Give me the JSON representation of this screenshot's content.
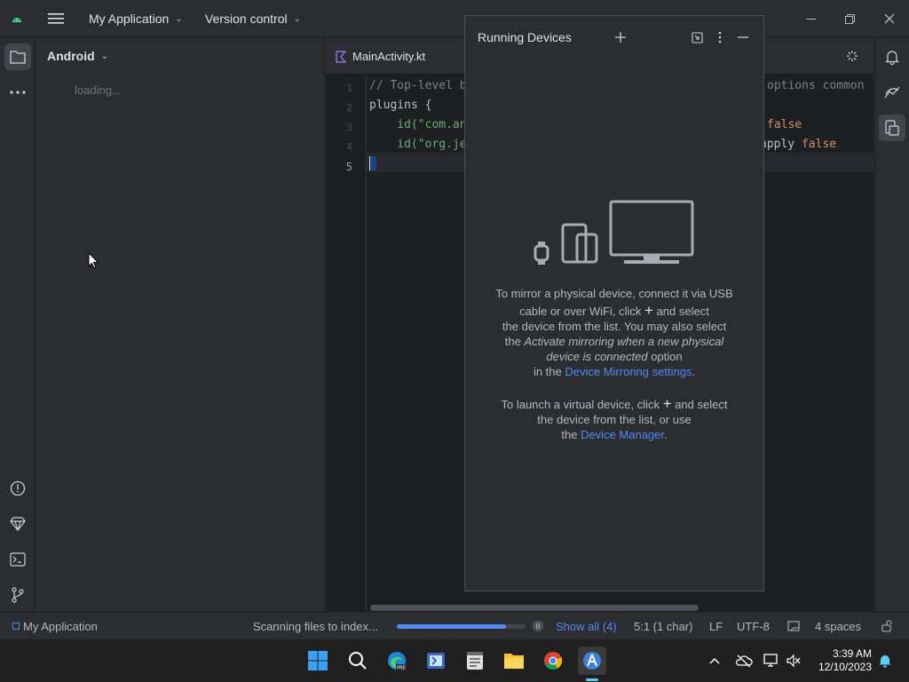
{
  "titlebar": {
    "project_name": "My Application",
    "vcs_label": "Version control"
  },
  "project_panel": {
    "title": "Android",
    "loading_text": "loading..."
  },
  "editor": {
    "tab_label": "MainActivity.kt",
    "line_numbers": [
      "1",
      "2",
      "3",
      "4",
      "5"
    ],
    "lines": {
      "l1_comment": "// Top-level b",
      "l1_right": "options common",
      "l2": "plugins {",
      "l3_left": "    id(\"com.an",
      "l3_right": "false",
      "l4_left": "    id(\"org.je",
      "l4_right_text": "apply ",
      "l4_right_kw": "false"
    }
  },
  "running_devices": {
    "title": "Running Devices",
    "para1_line1": "To mirror a physical device, connect it via USB",
    "para1_line2a": "cable or over WiFi, click",
    "para1_line2b": "and select",
    "para1_line3": "the device from the list. You may also select",
    "para1_line4a": "the",
    "para1_line4_italic": "Activate mirroring when a new physical",
    "para1_line5_italic": "device is connected",
    "para1_line5b": "option",
    "para1_line6a": "in the",
    "para1_line6_link": "Device Mirroring settings",
    "para1_line6b": ".",
    "para2_line1a": "To launch a virtual device, click",
    "para2_line1b": "and select",
    "para2_line2": "the device from the list, or use",
    "para2_line3a": "the",
    "para2_line3_link": "Device Manager",
    "para2_line3b": "."
  },
  "statusbar": {
    "project": "My Application",
    "scanning": "Scanning files to index...",
    "progress_fraction": 0.85,
    "show_all": "Show all (4)",
    "position": "5:1 (1 char)",
    "line_sep": "LF",
    "encoding": "UTF-8",
    "indent": "4 spaces"
  },
  "taskbar": {
    "time": "3:39 AM",
    "date": "12/10/2023"
  },
  "colors": {
    "accent": "#548af7",
    "background": "#2b2d30",
    "editor_bg": "#1e1f22"
  }
}
